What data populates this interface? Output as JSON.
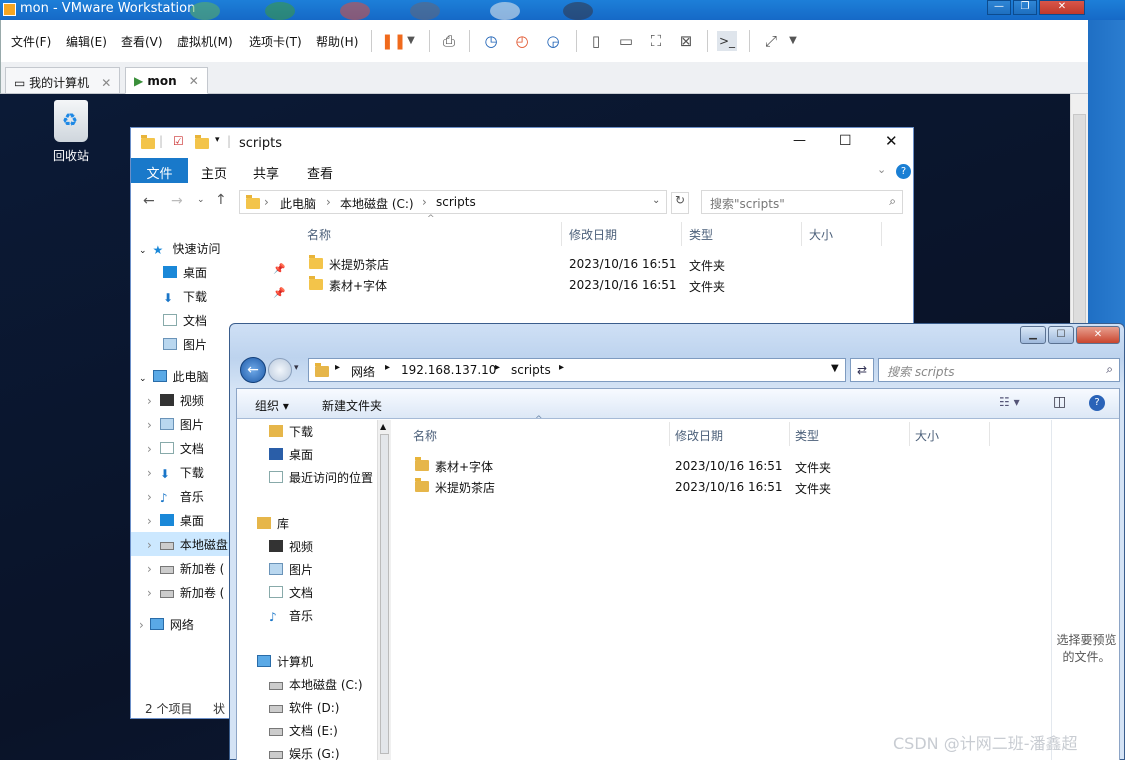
{
  "vmware": {
    "title": "mon - VMware Workstation",
    "menu": [
      "文件(F)",
      "编辑(E)",
      "查看(V)",
      "虚拟机(M)",
      "选项卡(T)",
      "帮助(H)"
    ],
    "tabs": [
      {
        "label": "我的计算机"
      },
      {
        "label": "mon"
      }
    ],
    "window_controls": [
      "—",
      "❐",
      "✕"
    ]
  },
  "desktop": {
    "recycle_bin": "回收站"
  },
  "win10_explorer": {
    "title": "scripts",
    "ribbon_tabs": [
      "文件",
      "主页",
      "共享",
      "查看"
    ],
    "breadcrumb": [
      "此电脑",
      "本地磁盘 (C:)",
      "scripts"
    ],
    "search_placeholder": "搜索\"scripts\"",
    "nav": {
      "quick_access": "快速访问",
      "quick_items": [
        "桌面",
        "下载",
        "文档",
        "图片"
      ],
      "this_pc": "此电脑",
      "pc_items": [
        "视频",
        "图片",
        "文档",
        "下载",
        "音乐",
        "桌面",
        "本地磁盘",
        "新加卷 (",
        "新加卷 ("
      ],
      "network": "网络"
    },
    "columns": {
      "name": "名称",
      "modified": "修改日期",
      "type": "类型",
      "size": "大小"
    },
    "rows": [
      {
        "name": "米提奶茶店",
        "modified": "2023/10/16 16:51",
        "type": "文件夹"
      },
      {
        "name": "素材+字体",
        "modified": "2023/10/16 16:51",
        "type": "文件夹"
      }
    ],
    "status": "2 个项目",
    "status2": "状",
    "controls": {
      "min": "—",
      "max": "☐",
      "close": "✕"
    }
  },
  "win7_explorer": {
    "breadcrumb": [
      "网络",
      "192.168.137.10",
      "scripts"
    ],
    "search_placeholder": "搜索 scripts",
    "commands": {
      "organize": "组织 ▾",
      "new_folder": "新建文件夹"
    },
    "nav": {
      "top_items": [
        "下载",
        "桌面",
        "最近访问的位置"
      ],
      "library": "库",
      "lib_items": [
        "视频",
        "图片",
        "文档",
        "音乐"
      ],
      "computer": "计算机",
      "drives": [
        "本地磁盘 (C:)",
        "软件 (D:)",
        "文档 (E:)",
        "娱乐 (G:)"
      ]
    },
    "columns": {
      "name": "名称",
      "modified": "修改日期",
      "type": "类型",
      "size": "大小"
    },
    "rows": [
      {
        "name": "素材+字体",
        "modified": "2023/10/16 16:51",
        "type": "文件夹"
      },
      {
        "name": "米提奶茶店",
        "modified": "2023/10/16 16:51",
        "type": "文件夹"
      }
    ],
    "preview_text": "选择要预览的文件。"
  },
  "watermark": "CSDN @计网二班-潘鑫超"
}
